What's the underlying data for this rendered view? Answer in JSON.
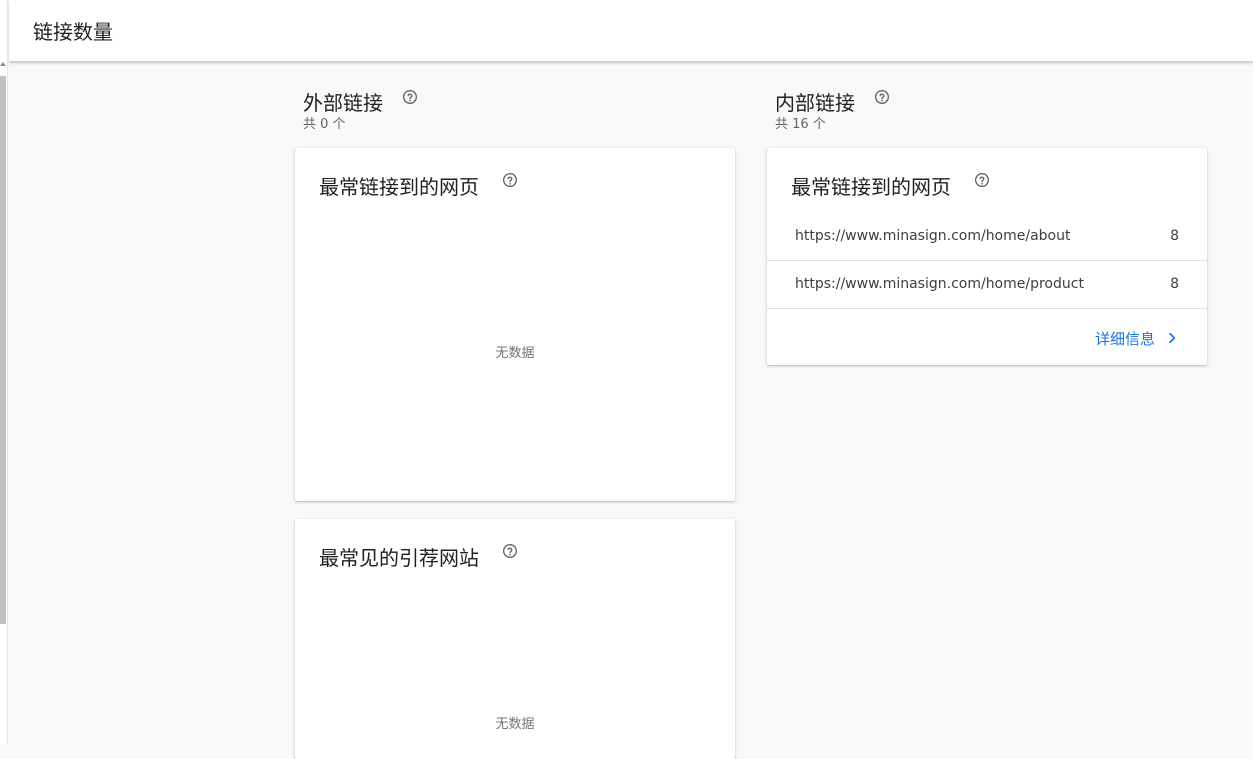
{
  "header": {
    "title": "链接数量"
  },
  "external": {
    "title": "外部链接",
    "count_label": "共 0 个",
    "top_linked_pages": {
      "title": "最常链接到的网页",
      "empty_text": "无数据"
    },
    "top_linking_sites": {
      "title": "最常见的引荐网站",
      "empty_text": "无数据"
    }
  },
  "internal": {
    "title": "内部链接",
    "count_label": "共 16 个",
    "top_linked_pages": {
      "title": "最常链接到的网页",
      "rows": [
        {
          "url": "https://www.minasign.com/home/about",
          "count": "8"
        },
        {
          "url": "https://www.minasign.com/home/product",
          "count": "8"
        }
      ],
      "details_label": "详细信息"
    }
  },
  "icons": {
    "help": "help-circle-icon",
    "chevron": "chevron-right-icon"
  },
  "colors": {
    "link": "#1a73e8",
    "background": "#f9f9f9",
    "card": "#ffffff"
  }
}
